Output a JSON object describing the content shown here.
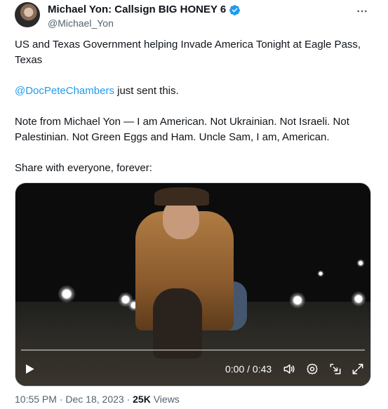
{
  "author": {
    "display_name": "Michael Yon: Callsign BIG HONEY 6",
    "handle": "@Michael_Yon",
    "verified": true
  },
  "more_icon": "more-horizontal-icon",
  "body": {
    "line1": "US and Texas Government helping Invade America Tonight at Eagle Pass, Texas",
    "mention": "@DocPeteChambers",
    "mention_suffix": " just sent this.",
    "note": "Note from Michael Yon — I am American.  Not Ukrainian.  Not Israeli.  Not Palestinian.  Not Green Eggs and Ham. Uncle Sam, I am, American.",
    "share": "Share with everyone, forever:"
  },
  "video": {
    "time": "0:00 / 0:43",
    "progress": 0,
    "icons": [
      "play-icon",
      "volume-icon",
      "settings-icon",
      "pip-icon",
      "fullscreen-icon"
    ]
  },
  "meta": {
    "time": "10:55 PM",
    "separator": " · ",
    "date": "Dec 18, 2023",
    "views_count": "25K",
    "views_label": " Views"
  },
  "colors": {
    "accent": "#1d9bf0",
    "text": "#0f1419",
    "secondary": "#536471"
  }
}
